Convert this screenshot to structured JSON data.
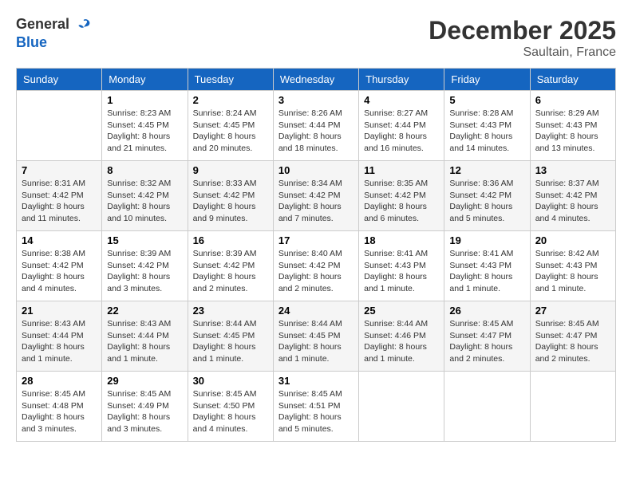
{
  "header": {
    "logo_general": "General",
    "logo_blue": "Blue",
    "month_title": "December 2025",
    "location": "Saultain, France"
  },
  "days_of_week": [
    "Sunday",
    "Monday",
    "Tuesday",
    "Wednesday",
    "Thursday",
    "Friday",
    "Saturday"
  ],
  "weeks": [
    [
      {
        "day": "",
        "sunrise": "",
        "sunset": "",
        "daylight": ""
      },
      {
        "day": "1",
        "sunrise": "Sunrise: 8:23 AM",
        "sunset": "Sunset: 4:45 PM",
        "daylight": "Daylight: 8 hours and 21 minutes."
      },
      {
        "day": "2",
        "sunrise": "Sunrise: 8:24 AM",
        "sunset": "Sunset: 4:45 PM",
        "daylight": "Daylight: 8 hours and 20 minutes."
      },
      {
        "day": "3",
        "sunrise": "Sunrise: 8:26 AM",
        "sunset": "Sunset: 4:44 PM",
        "daylight": "Daylight: 8 hours and 18 minutes."
      },
      {
        "day": "4",
        "sunrise": "Sunrise: 8:27 AM",
        "sunset": "Sunset: 4:44 PM",
        "daylight": "Daylight: 8 hours and 16 minutes."
      },
      {
        "day": "5",
        "sunrise": "Sunrise: 8:28 AM",
        "sunset": "Sunset: 4:43 PM",
        "daylight": "Daylight: 8 hours and 14 minutes."
      },
      {
        "day": "6",
        "sunrise": "Sunrise: 8:29 AM",
        "sunset": "Sunset: 4:43 PM",
        "daylight": "Daylight: 8 hours and 13 minutes."
      }
    ],
    [
      {
        "day": "7",
        "sunrise": "Sunrise: 8:31 AM",
        "sunset": "Sunset: 4:42 PM",
        "daylight": "Daylight: 8 hours and 11 minutes."
      },
      {
        "day": "8",
        "sunrise": "Sunrise: 8:32 AM",
        "sunset": "Sunset: 4:42 PM",
        "daylight": "Daylight: 8 hours and 10 minutes."
      },
      {
        "day": "9",
        "sunrise": "Sunrise: 8:33 AM",
        "sunset": "Sunset: 4:42 PM",
        "daylight": "Daylight: 8 hours and 9 minutes."
      },
      {
        "day": "10",
        "sunrise": "Sunrise: 8:34 AM",
        "sunset": "Sunset: 4:42 PM",
        "daylight": "Daylight: 8 hours and 7 minutes."
      },
      {
        "day": "11",
        "sunrise": "Sunrise: 8:35 AM",
        "sunset": "Sunset: 4:42 PM",
        "daylight": "Daylight: 8 hours and 6 minutes."
      },
      {
        "day": "12",
        "sunrise": "Sunrise: 8:36 AM",
        "sunset": "Sunset: 4:42 PM",
        "daylight": "Daylight: 8 hours and 5 minutes."
      },
      {
        "day": "13",
        "sunrise": "Sunrise: 8:37 AM",
        "sunset": "Sunset: 4:42 PM",
        "daylight": "Daylight: 8 hours and 4 minutes."
      }
    ],
    [
      {
        "day": "14",
        "sunrise": "Sunrise: 8:38 AM",
        "sunset": "Sunset: 4:42 PM",
        "daylight": "Daylight: 8 hours and 4 minutes."
      },
      {
        "day": "15",
        "sunrise": "Sunrise: 8:39 AM",
        "sunset": "Sunset: 4:42 PM",
        "daylight": "Daylight: 8 hours and 3 minutes."
      },
      {
        "day": "16",
        "sunrise": "Sunrise: 8:39 AM",
        "sunset": "Sunset: 4:42 PM",
        "daylight": "Daylight: 8 hours and 2 minutes."
      },
      {
        "day": "17",
        "sunrise": "Sunrise: 8:40 AM",
        "sunset": "Sunset: 4:42 PM",
        "daylight": "Daylight: 8 hours and 2 minutes."
      },
      {
        "day": "18",
        "sunrise": "Sunrise: 8:41 AM",
        "sunset": "Sunset: 4:43 PM",
        "daylight": "Daylight: 8 hours and 1 minute."
      },
      {
        "day": "19",
        "sunrise": "Sunrise: 8:41 AM",
        "sunset": "Sunset: 4:43 PM",
        "daylight": "Daylight: 8 hours and 1 minute."
      },
      {
        "day": "20",
        "sunrise": "Sunrise: 8:42 AM",
        "sunset": "Sunset: 4:43 PM",
        "daylight": "Daylight: 8 hours and 1 minute."
      }
    ],
    [
      {
        "day": "21",
        "sunrise": "Sunrise: 8:43 AM",
        "sunset": "Sunset: 4:44 PM",
        "daylight": "Daylight: 8 hours and 1 minute."
      },
      {
        "day": "22",
        "sunrise": "Sunrise: 8:43 AM",
        "sunset": "Sunset: 4:44 PM",
        "daylight": "Daylight: 8 hours and 1 minute."
      },
      {
        "day": "23",
        "sunrise": "Sunrise: 8:44 AM",
        "sunset": "Sunset: 4:45 PM",
        "daylight": "Daylight: 8 hours and 1 minute."
      },
      {
        "day": "24",
        "sunrise": "Sunrise: 8:44 AM",
        "sunset": "Sunset: 4:45 PM",
        "daylight": "Daylight: 8 hours and 1 minute."
      },
      {
        "day": "25",
        "sunrise": "Sunrise: 8:44 AM",
        "sunset": "Sunset: 4:46 PM",
        "daylight": "Daylight: 8 hours and 1 minute."
      },
      {
        "day": "26",
        "sunrise": "Sunrise: 8:45 AM",
        "sunset": "Sunset: 4:47 PM",
        "daylight": "Daylight: 8 hours and 2 minutes."
      },
      {
        "day": "27",
        "sunrise": "Sunrise: 8:45 AM",
        "sunset": "Sunset: 4:47 PM",
        "daylight": "Daylight: 8 hours and 2 minutes."
      }
    ],
    [
      {
        "day": "28",
        "sunrise": "Sunrise: 8:45 AM",
        "sunset": "Sunset: 4:48 PM",
        "daylight": "Daylight: 8 hours and 3 minutes."
      },
      {
        "day": "29",
        "sunrise": "Sunrise: 8:45 AM",
        "sunset": "Sunset: 4:49 PM",
        "daylight": "Daylight: 8 hours and 3 minutes."
      },
      {
        "day": "30",
        "sunrise": "Sunrise: 8:45 AM",
        "sunset": "Sunset: 4:50 PM",
        "daylight": "Daylight: 8 hours and 4 minutes."
      },
      {
        "day": "31",
        "sunrise": "Sunrise: 8:45 AM",
        "sunset": "Sunset: 4:51 PM",
        "daylight": "Daylight: 8 hours and 5 minutes."
      },
      {
        "day": "",
        "sunrise": "",
        "sunset": "",
        "daylight": ""
      },
      {
        "day": "",
        "sunrise": "",
        "sunset": "",
        "daylight": ""
      },
      {
        "day": "",
        "sunrise": "",
        "sunset": "",
        "daylight": ""
      }
    ]
  ]
}
